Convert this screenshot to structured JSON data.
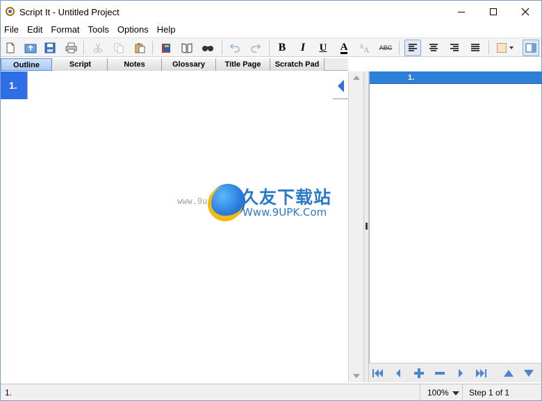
{
  "window": {
    "title": "Script It - Untitled Project"
  },
  "menu": [
    "File",
    "Edit",
    "Format",
    "Tools",
    "Options",
    "Help"
  ],
  "toolbar": {
    "buttons": [
      "new-file-icon",
      "open-file-icon",
      "save-icon",
      "print-icon",
      "cut-icon",
      "copy-icon",
      "paste-icon",
      "book-color-icon",
      "book-open-icon",
      "find-icon",
      "undo-icon",
      "redo-icon",
      "bold-icon",
      "italic-icon",
      "underline-icon",
      "font-color-icon",
      "font-size-icon",
      "spell-check-icon",
      "align-left-icon",
      "align-center-icon",
      "align-right-icon",
      "align-justify-icon",
      "highlight-color-icon",
      "toggle-pane-icon"
    ],
    "bold": "B",
    "italic": "I",
    "underline": "U",
    "font_color": "A",
    "spell": "ABC"
  },
  "tabs": [
    "Outline",
    "Script",
    "Notes",
    "Glossary",
    "Title Page",
    "Scratch Pad"
  ],
  "active_tab": "Outline",
  "outline": {
    "rows": [
      {
        "number": "1.",
        "text": ""
      }
    ]
  },
  "right_pane": {
    "header": "1."
  },
  "status": {
    "left": "1.",
    "zoom": "100%",
    "step": "Step 1 of 1"
  },
  "watermark": {
    "title": "久友下载站",
    "sub": "Www.9UPK.Com",
    "prefix": "www.9u"
  },
  "colors": {
    "accent": "#2e6fe8",
    "header_blue": "#2e7fd8"
  }
}
